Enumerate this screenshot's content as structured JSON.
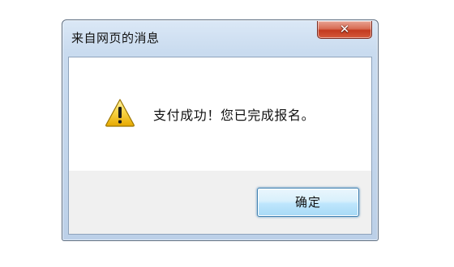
{
  "dialog": {
    "title": "来自网页的消息",
    "close_icon": "close-icon",
    "message": "支付成功！您已完成报名。",
    "message_icon": "warning-icon",
    "ok_label": "确定"
  },
  "colors": {
    "title_bar": "#c9dbef",
    "close_button": "#c33a1f",
    "ok_button": "#bee6fd",
    "warning": "#f2c200"
  }
}
